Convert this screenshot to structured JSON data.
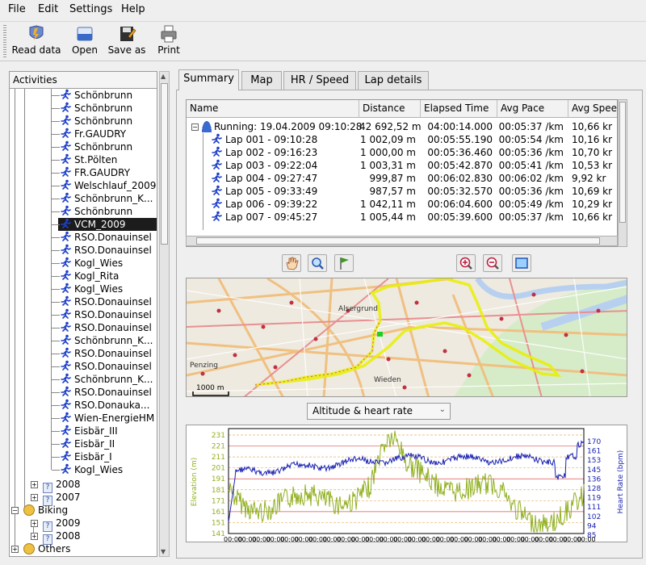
{
  "menu": [
    "File",
    "Edit",
    "Settings",
    "Help"
  ],
  "toolbar": [
    {
      "label": "Read data",
      "icon": "read-data-icon"
    },
    {
      "label": "Open",
      "icon": "open-icon"
    },
    {
      "label": "Save as",
      "icon": "save-as-icon"
    },
    {
      "label": "Print",
      "icon": "print-icon"
    }
  ],
  "activities": {
    "header": "Activities",
    "running_items": [
      "Schönbrunn",
      "Schönbrunn",
      "Schönbrunn",
      "Fr.GAUDRY",
      "Schönbrunn",
      "St.Pölten",
      "FR.GAUDRY",
      "Welschlauf_2009",
      "Schönbrunn_K...",
      "Schönbrunn",
      "VCM_2009",
      "RSO.Donauinsel",
      "RSO.Donauinsel",
      "Kogl_Wies",
      "Kogl_Rita",
      "Kogl_Wies",
      "RSO.Donauinsel",
      "RSO.Donauinsel",
      "RSO.Donauinsel",
      "Schönbrunn_K...",
      "RSO.Donauinsel",
      "RSO.Donauinsel",
      "Schönbrunn_K...",
      "RSO.Donauinsel",
      "RSO.Donauka...",
      "Wien-EnergieHM",
      "Eisbär_III",
      "Eisbär_II",
      "Eisbär_I",
      "Kogl_Wies"
    ],
    "selected": "VCM_2009",
    "years": [
      "2008",
      "2007"
    ],
    "biking": "Biking",
    "biking_years": [
      "2009",
      "2008"
    ],
    "others": "Others"
  },
  "tabs": [
    "Summary",
    "Map",
    "HR / Speed",
    "Lap details"
  ],
  "table": {
    "columns": [
      "Name",
      "Distance",
      "Elapsed Time",
      "Avg Pace",
      "Avg Spee"
    ],
    "summary": [
      "Running: 19.04.2009 09:10:28",
      "42 692,52 m",
      "04:00:14.000",
      "00:05:37 /km",
      "10,66 kr"
    ],
    "laps": [
      [
        "Lap 001 - 09:10:28",
        "1 002,09 m",
        "00:05:55.190",
        "00:05:54 /km",
        "10,16 kr"
      ],
      [
        "Lap 002 - 09:16:23",
        "1 000,00 m",
        "00:05:36.460",
        "00:05:36 /km",
        "10,70 kr"
      ],
      [
        "Lap 003 - 09:22:04",
        "1 003,31 m",
        "00:05:42.870",
        "00:05:41 /km",
        "10,53 kr"
      ],
      [
        "Lap 004 - 09:27:47",
        "999,87 m",
        "00:06:02.830",
        "00:06:02 /km",
        "9,92 kr"
      ],
      [
        "Lap 005 - 09:33:49",
        "987,57 m",
        "00:05:32.570",
        "00:05:36 /km",
        "10,69 kr"
      ],
      [
        "Lap 006 - 09:39:22",
        "1 042,11 m",
        "00:06:04.600",
        "00:05:49 /km",
        "10,29 kr"
      ],
      [
        "Lap 007 - 09:45:27",
        "1 005,44 m",
        "00:05:39.600",
        "00:05:37 /km",
        "10,66 kr"
      ]
    ]
  },
  "map_buttons": [
    "hand-icon",
    "zoom-icon",
    "flag-icon",
    "zoom-in-icon",
    "zoom-out-icon",
    "fit-icon"
  ],
  "map": {
    "labels": [
      "Alsergrund",
      "Penzing",
      "Wieden"
    ],
    "scale": "1000 m"
  },
  "chart_select": "Altitude & heart rate",
  "chart_data": {
    "type": "line",
    "ylabel": "Elevation (m)",
    "ylabel2": "Heart Rate (bpm)",
    "yticks": [
      "231",
      "221",
      "211",
      "201",
      "191",
      "181",
      "171",
      "161",
      "151",
      "141"
    ],
    "yticks2": [
      "170",
      "161",
      "153",
      "145",
      "136",
      "128",
      "119",
      "111",
      "102",
      "94",
      "85"
    ],
    "xtick": "00:00",
    "colors": {
      "elevation": "#90b020",
      "heart_rate": "#1a22b0"
    }
  }
}
